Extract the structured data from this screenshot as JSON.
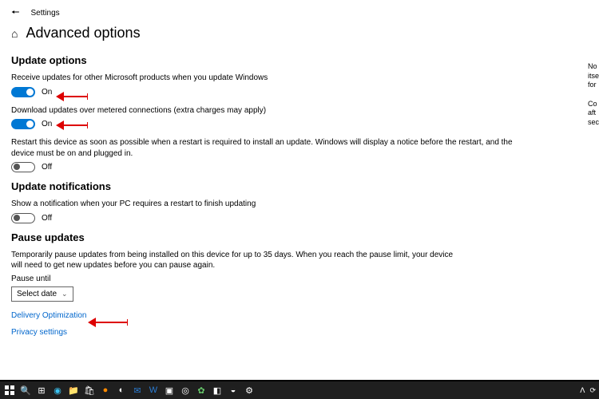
{
  "app": {
    "name": "Settings"
  },
  "page": {
    "title": "Advanced options"
  },
  "sections": {
    "updateOptions": {
      "heading": "Update options",
      "items": [
        {
          "label": "Receive updates for other Microsoft products when you update Windows",
          "state": "On",
          "on": true
        },
        {
          "label": "Download updates over metered connections (extra charges may apply)",
          "state": "On",
          "on": true
        },
        {
          "label": "Restart this device as soon as possible when a restart is required to install an update. Windows will display a notice before the restart, and the device must be on and plugged in.",
          "state": "Off",
          "on": false
        }
      ]
    },
    "updateNotifications": {
      "heading": "Update notifications",
      "items": [
        {
          "label": "Show a notification when your PC requires a restart to finish updating",
          "state": "Off",
          "on": false
        }
      ]
    },
    "pauseUpdates": {
      "heading": "Pause updates",
      "desc": "Temporarily pause updates from being installed on this device for up to 35 days. When you reach the pause limit, your device will need to get new updates before you can pause again.",
      "fieldLabel": "Pause until",
      "selectPlaceholder": "Select date"
    }
  },
  "links": {
    "delivery": "Delivery Optimization",
    "privacy": "Privacy settings"
  },
  "rightCol": "No\nitse\nfor\n\nCo\naft\nsec",
  "tray": {
    "caret": "ᐱ"
  }
}
